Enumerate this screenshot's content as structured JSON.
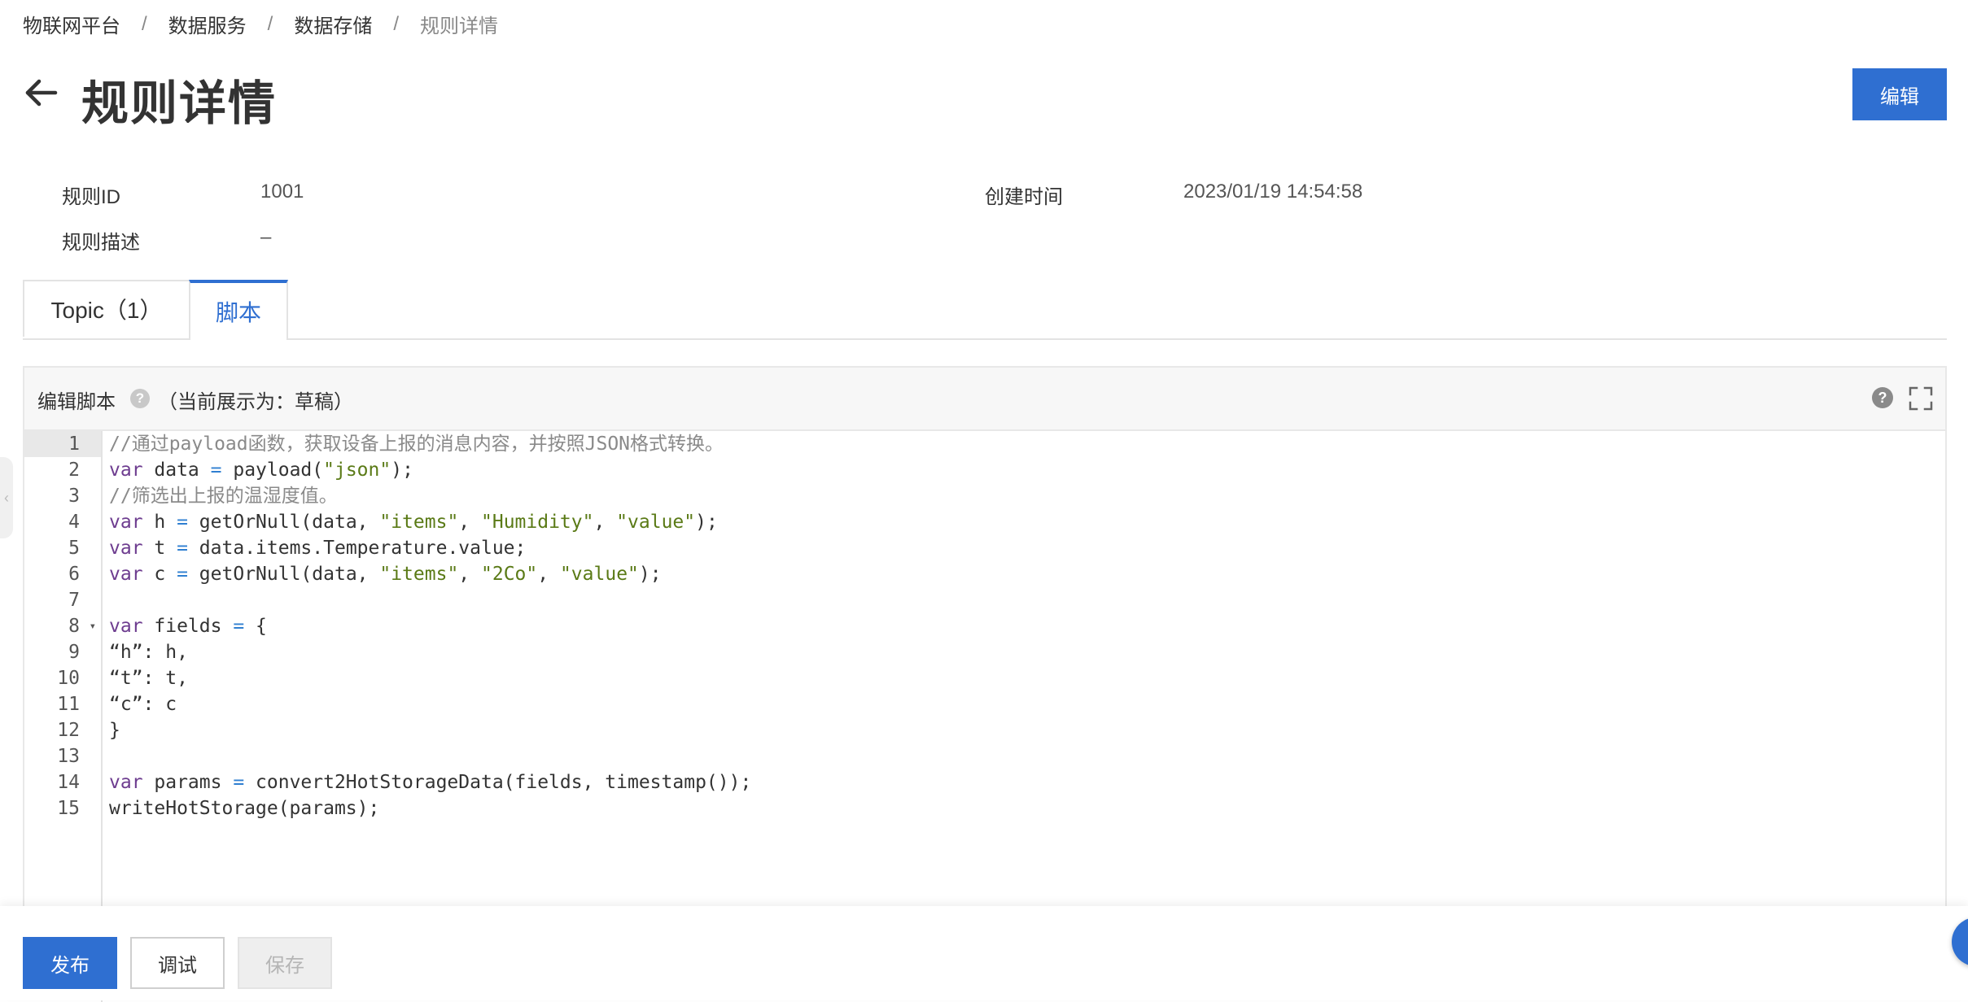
{
  "breadcrumb": {
    "items": [
      "物联网平台",
      "数据服务",
      "数据存储"
    ],
    "current": "规则详情",
    "separator": "/"
  },
  "header": {
    "title": "规则详情",
    "edit_label": "编辑"
  },
  "info": {
    "rule_id_label": "规则ID",
    "rule_id_value": "1001",
    "created_label": "创建时间",
    "created_value": "2023/01/19 14:54:58",
    "desc_label": "规则描述",
    "desc_value": "–"
  },
  "tabs": {
    "topic_label": "Topic（1）",
    "script_label": "脚本",
    "active": "脚本"
  },
  "editor": {
    "title": "编辑脚本",
    "status": "（当前展示为：草稿）",
    "help_glyph": "?",
    "active_line": 1,
    "line_numbers": [
      "1",
      "2",
      "3",
      "4",
      "5",
      "6",
      "7",
      "8",
      "9",
      "10",
      "11",
      "12",
      "13",
      "14",
      "15"
    ],
    "lines": [
      [
        {
          "t": "c",
          "v": "//通过payload函数，获取设备上报的消息内容，并按照JSON格式转换。"
        }
      ],
      [
        {
          "t": "k",
          "v": "var"
        },
        {
          "t": "p",
          "v": " data "
        },
        {
          "t": "o",
          "v": "="
        },
        {
          "t": "p",
          "v": " payload("
        },
        {
          "t": "s",
          "v": "\"json\""
        },
        {
          "t": "p",
          "v": ");"
        }
      ],
      [
        {
          "t": "c",
          "v": "//筛选出上报的温湿度值。"
        }
      ],
      [
        {
          "t": "k",
          "v": "var"
        },
        {
          "t": "p",
          "v": " h "
        },
        {
          "t": "o",
          "v": "="
        },
        {
          "t": "p",
          "v": " getOrNull(data, "
        },
        {
          "t": "s",
          "v": "\"items\""
        },
        {
          "t": "p",
          "v": ", "
        },
        {
          "t": "s",
          "v": "\"Humidity\""
        },
        {
          "t": "p",
          "v": ", "
        },
        {
          "t": "s",
          "v": "\"value\""
        },
        {
          "t": "p",
          "v": ");"
        }
      ],
      [
        {
          "t": "k",
          "v": "var"
        },
        {
          "t": "p",
          "v": " t "
        },
        {
          "t": "o",
          "v": "="
        },
        {
          "t": "p",
          "v": " data.items.Temperature.value;"
        }
      ],
      [
        {
          "t": "k",
          "v": "var"
        },
        {
          "t": "p",
          "v": " c "
        },
        {
          "t": "o",
          "v": "="
        },
        {
          "t": "p",
          "v": " getOrNull(data, "
        },
        {
          "t": "s",
          "v": "\"items\""
        },
        {
          "t": "p",
          "v": ", "
        },
        {
          "t": "s",
          "v": "\"2Co\""
        },
        {
          "t": "p",
          "v": ", "
        },
        {
          "t": "s",
          "v": "\"value\""
        },
        {
          "t": "p",
          "v": ");"
        }
      ],
      [],
      [
        {
          "t": "k",
          "v": "var"
        },
        {
          "t": "p",
          "v": " fields "
        },
        {
          "t": "o",
          "v": "="
        },
        {
          "t": "p",
          "v": " {"
        }
      ],
      [
        {
          "t": "p",
          "v": "“h”: h,"
        }
      ],
      [
        {
          "t": "p",
          "v": "“t”: t,"
        }
      ],
      [
        {
          "t": "p",
          "v": "“c”: c"
        }
      ],
      [
        {
          "t": "p",
          "v": "}"
        }
      ],
      [],
      [
        {
          "t": "k",
          "v": "var"
        },
        {
          "t": "p",
          "v": " params "
        },
        {
          "t": "o",
          "v": "="
        },
        {
          "t": "p",
          "v": " convert2HotStorageData(fields, timestamp());"
        }
      ],
      [
        {
          "t": "p",
          "v": "writeHotStorage(params);"
        }
      ]
    ],
    "fold_line": 8
  },
  "footer": {
    "publish_label": "发布",
    "debug_label": "调试",
    "save_label": "保存"
  },
  "colors": {
    "primary": "#2f6fd1",
    "keyword": "#6d3c8f",
    "string": "#5a7a16",
    "comment": "#8a8a8a",
    "operator": "#2f7fd1"
  }
}
